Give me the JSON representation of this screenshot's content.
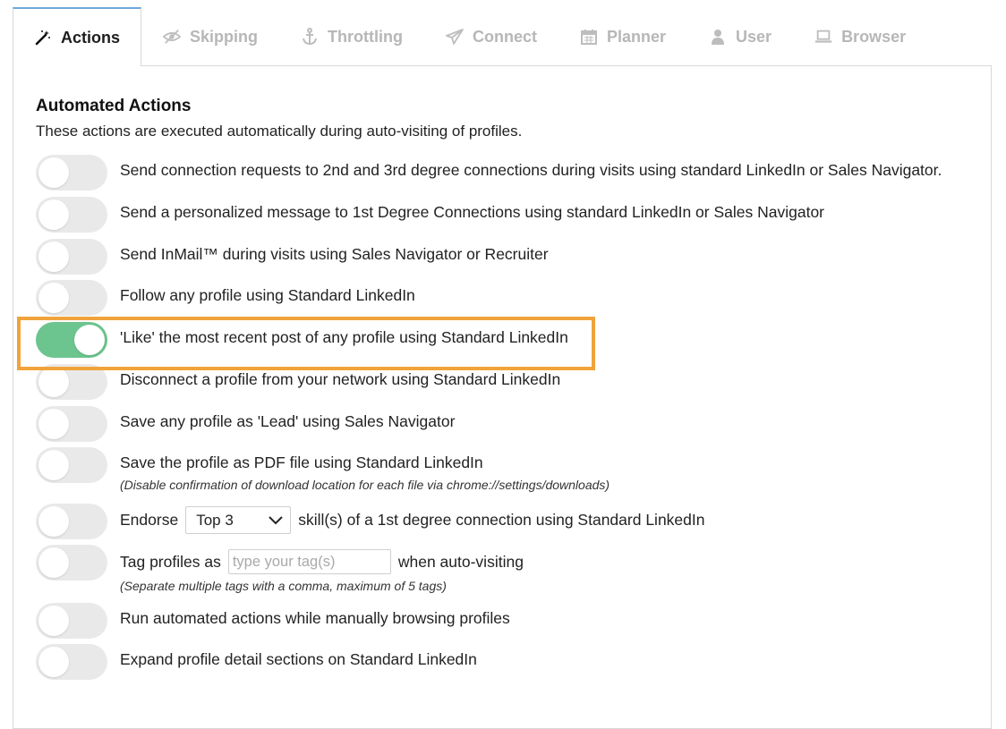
{
  "tabs": [
    {
      "label": "Actions",
      "icon": "magic-wand-icon"
    },
    {
      "label": "Skipping",
      "icon": "eye-slash-icon"
    },
    {
      "label": "Throttling",
      "icon": "anchor-icon"
    },
    {
      "label": "Connect",
      "icon": "paper-plane-icon"
    },
    {
      "label": "Planner",
      "icon": "calendar-icon"
    },
    {
      "label": "User",
      "icon": "user-icon"
    },
    {
      "label": "Browser",
      "icon": "laptop-icon"
    }
  ],
  "active_tab": "Actions",
  "section": {
    "title": "Automated Actions",
    "subtitle": "These actions are executed automatically during auto-visiting of profiles."
  },
  "actions": [
    {
      "label": "Send connection requests to 2nd and 3rd degree connections during visits using standard LinkedIn or Sales Navigator.",
      "enabled": false
    },
    {
      "label": "Send a personalized message to 1st Degree Connections using standard LinkedIn or Sales Navigator",
      "enabled": false
    },
    {
      "label": "Send InMail™ during visits using Sales Navigator or Recruiter",
      "enabled": false
    },
    {
      "label": "Follow any profile using Standard LinkedIn",
      "enabled": false
    },
    {
      "label": "'Like' the most recent post of any profile using Standard LinkedIn",
      "enabled": true
    },
    {
      "label": "Disconnect a profile from your network using Standard LinkedIn",
      "enabled": false
    },
    {
      "label": "Save any profile as 'Lead' using Sales Navigator",
      "enabled": false
    },
    {
      "label": "Save the profile as PDF file using Standard LinkedIn",
      "note": "(Disable confirmation of download location for each file via chrome://settings/downloads)",
      "enabled": false
    },
    {
      "label_pre": "Endorse",
      "select_value": "Top 3",
      "label_post": "skill(s) of a 1st degree connection using Standard LinkedIn",
      "enabled": false
    },
    {
      "label_pre": "Tag profiles as",
      "input_placeholder": "type your tag(s)",
      "input_value": "",
      "label_post": "when auto-visiting",
      "note": "(Separate multiple tags with a comma, maximum of 5 tags)",
      "enabled": false
    },
    {
      "label": "Run automated actions while manually browsing profiles",
      "enabled": false
    },
    {
      "label": "Expand profile detail sections on Standard LinkedIn",
      "enabled": false
    }
  ],
  "colors": {
    "toggle_on": "#6cc48e",
    "toggle_off": "#e9e9e9",
    "highlight": "#f0a33a",
    "active_tab_border": "#6fa8dc"
  }
}
